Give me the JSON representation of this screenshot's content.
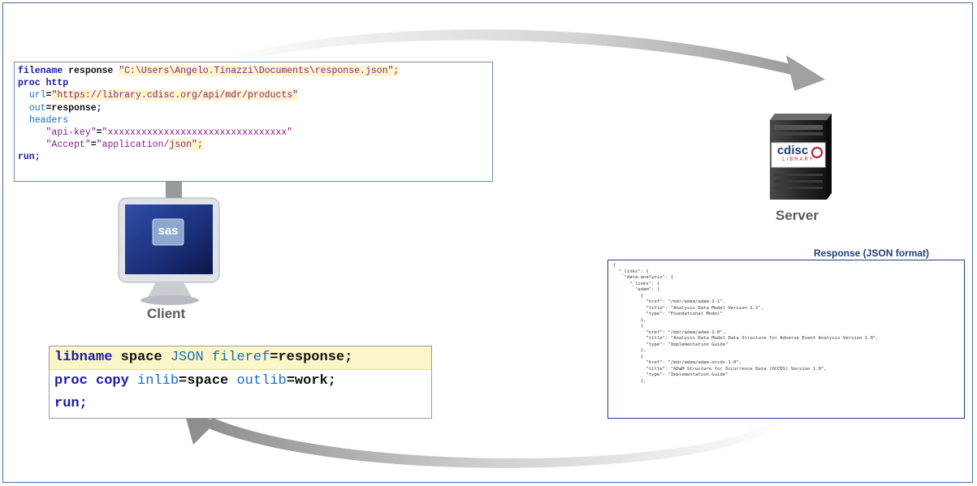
{
  "client_code": {
    "lines": [
      [
        {
          "t": "filename",
          "c": "kw"
        },
        {
          "t": " response ",
          "c": "bold"
        },
        {
          "t": "\"C:\\Users\\Angelo.Tinazzi\\Documents\\response.json\";",
          "c": "str hl"
        }
      ],
      [
        {
          "t": "proc http",
          "c": "kw"
        }
      ],
      [
        {
          "t": "  ",
          "c": ""
        },
        {
          "t": "url",
          "c": "opt"
        },
        {
          "t": "=",
          "c": "bold"
        },
        {
          "t": "\"https://library.cdisc.org/api/mdr/products\"",
          "c": "str hl"
        }
      ],
      [
        {
          "t": "  ",
          "c": ""
        },
        {
          "t": "out",
          "c": "opt"
        },
        {
          "t": "=response;",
          "c": "bold"
        }
      ],
      [
        {
          "t": "  ",
          "c": ""
        },
        {
          "t": "headers",
          "c": "opt"
        }
      ],
      [
        {
          "t": "     ",
          "c": ""
        },
        {
          "t": "\"api-key\"",
          "c": "str"
        },
        {
          "t": "=",
          "c": "bold"
        },
        {
          "t": "\"xxxxxxxxxxxxxxxxxxxxxxxxxxxxxxxx\"",
          "c": "str"
        }
      ],
      [
        {
          "t": "     ",
          "c": ""
        },
        {
          "t": "\"Accept\"",
          "c": "str"
        },
        {
          "t": "=",
          "c": "bold"
        },
        {
          "t": "\"application/",
          "c": "str"
        },
        {
          "t": "json\";",
          "c": "str hl"
        }
      ],
      [
        {
          "t": "run;",
          "c": "kw"
        }
      ]
    ]
  },
  "libname_code": {
    "lines": [
      [
        {
          "t": "libname",
          "c": "kw"
        },
        {
          "t": " space ",
          "c": "bold"
        },
        {
          "t": "JSON",
          "c": "opt"
        },
        {
          "t": " fileref",
          "c": "opt"
        },
        {
          "t": "=response;",
          "c": "bold"
        }
      ],
      [
        {
          "t": "proc copy ",
          "c": "kw"
        },
        {
          "t": "inlib",
          "c": "opt"
        },
        {
          "t": "=space ",
          "c": "bold"
        },
        {
          "t": "outlib",
          "c": "opt"
        },
        {
          "t": "=work;",
          "c": "bold"
        }
      ],
      [
        {
          "t": "run;",
          "c": "kw"
        }
      ]
    ]
  },
  "client_label": "Client",
  "client_logo_text": "sas",
  "server_label": "Server",
  "server_logo_text": "cdisc",
  "server_logo_sub": "LIBRARY",
  "response_title": "Response  (JSON format)",
  "response_lines": [
    "{",
    "  \"_links\": {",
    "    \"data-analysis\": {",
    "      \"_links\": {",
    "        \"adam\": [",
    "          {",
    "            \"href\": \"/mdr/adam/adam-2-1\",",
    "            \"title\": \"Analysis Data Model Version 2.1\",",
    "            \"type\": \"Foundational Model\"",
    "          },",
    "          {",
    "            \"href\": \"/mdr/adam/adae-1-0\",",
    "            \"title\": \"Analysis Data Model Data Structure for Adverse Event Analysis Version 1.0\",",
    "            \"type\": \"Implementation Guide\"",
    "          },",
    "          {",
    "            \"href\": \"/mdr/adam/adam-occds-1-0\",",
    "            \"title\": \"ADaM Structure for Occurrence Data (OCCDS) Version 1.0\",",
    "            \"type\": \"Implementation Guide\"",
    "          },"
  ],
  "colors": {
    "frame": "#4a6fa5",
    "highlight": "#fbf6c7",
    "keyword": "#1a1aa8",
    "string": "#8b1c8b",
    "option": "#1a6fbf",
    "response_border": "#1f3f7a"
  }
}
